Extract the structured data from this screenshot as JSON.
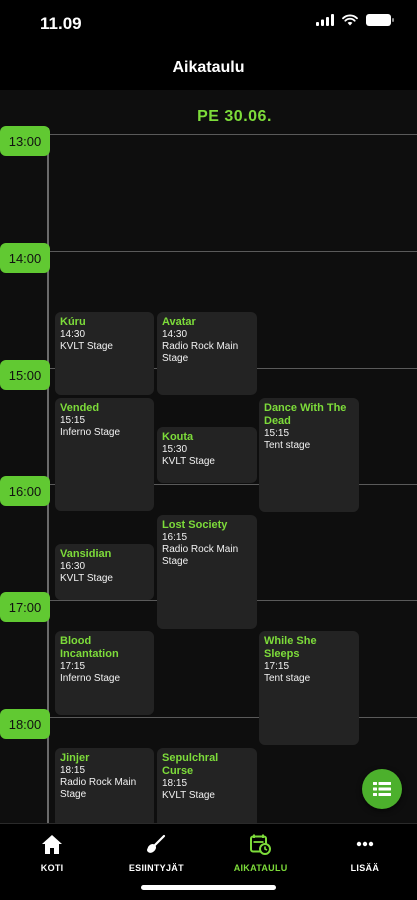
{
  "status": {
    "time": "11.09"
  },
  "header": {
    "title": "Aikataulu"
  },
  "day": "PE 30.06.",
  "hours": [
    "13:00",
    "14:00",
    "15:00",
    "16:00",
    "17:00",
    "18:00"
  ],
  "events": [
    {
      "name": "Kúru",
      "time": "14:30",
      "stage": "KVLT Stage"
    },
    {
      "name": "Avatar",
      "time": "14:30",
      "stage": "Radio Rock Main Stage"
    },
    {
      "name": "Vended",
      "time": "15:15",
      "stage": "Inferno Stage"
    },
    {
      "name": "Kouta",
      "time": "15:30",
      "stage": "KVLT Stage"
    },
    {
      "name": "Dance With The Dead",
      "time": "15:15",
      "stage": "Tent stage"
    },
    {
      "name": "Lost Society",
      "time": "16:15",
      "stage": "Radio Rock Main Stage"
    },
    {
      "name": "Vansidian",
      "time": "16:30",
      "stage": "KVLT Stage"
    },
    {
      "name": "Blood Incantation",
      "time": "17:15",
      "stage": "Inferno Stage"
    },
    {
      "name": "While She Sleeps",
      "time": "17:15",
      "stage": "Tent stage"
    },
    {
      "name": "Jinjer",
      "time": "18:15",
      "stage": "Radio Rock Main Stage"
    },
    {
      "name": "Sepulchral Curse",
      "time": "18:15",
      "stage": "KVLT Stage"
    }
  ],
  "tabs": [
    {
      "label": "KOTI",
      "icon": "home-icon"
    },
    {
      "label": "ESIINTYJÄT",
      "icon": "guitar-icon"
    },
    {
      "label": "AIKATAULU",
      "icon": "schedule-icon",
      "active": true
    },
    {
      "label": "LISÄÄ",
      "icon": "more-icon"
    }
  ],
  "colors": {
    "accent": "#7ddc3a",
    "pill": "#61c932",
    "card": "#232323",
    "background": "#0e0e0e"
  }
}
